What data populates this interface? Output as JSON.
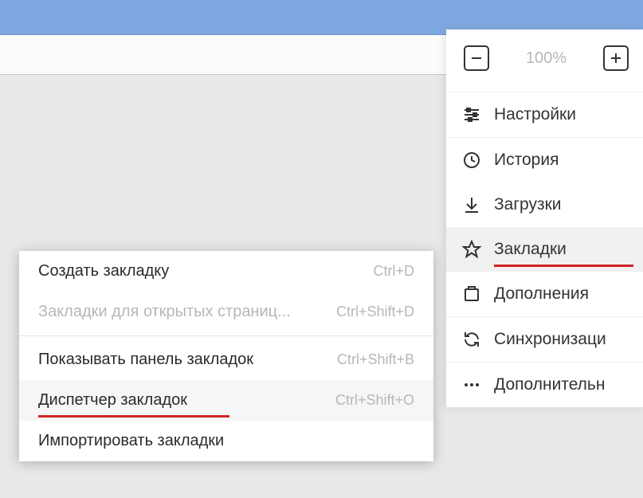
{
  "zoom": {
    "level": "100%"
  },
  "main_menu": {
    "settings": "Настройки",
    "history": "История",
    "downloads": "Загрузки",
    "bookmarks": "Закладки",
    "extensions": "Дополнения",
    "sync": "Синхронизаци",
    "more": "Дополнительн"
  },
  "submenu": {
    "create_bookmark": {
      "label": "Создать закладку",
      "shortcut": "Ctrl+D"
    },
    "bookmarks_for_open": {
      "label": "Закладки для открытых страниц...",
      "shortcut": "Ctrl+Shift+D"
    },
    "show_bar": {
      "label": "Показывать панель закладок",
      "shortcut": "Ctrl+Shift+B"
    },
    "manager": {
      "label": "Диспетчер закладок",
      "shortcut": "Ctrl+Shift+O"
    },
    "import": {
      "label": "Импортировать закладки"
    }
  }
}
